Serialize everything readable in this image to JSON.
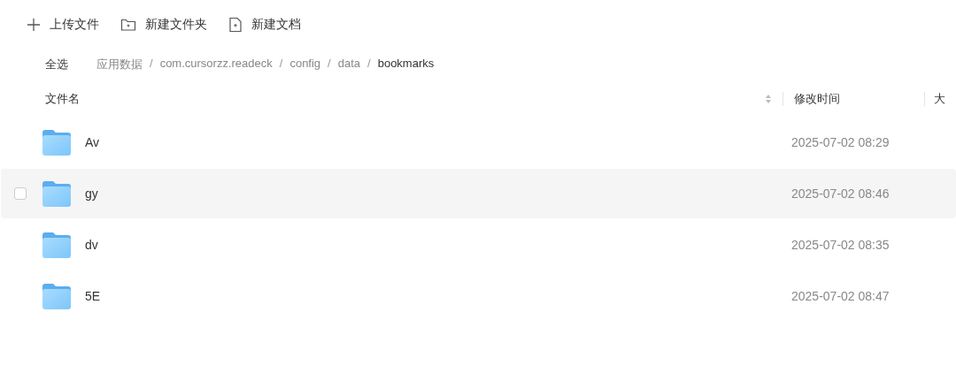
{
  "toolbar": [
    {
      "kind": "upload",
      "label": "上传文件"
    },
    {
      "kind": "folder",
      "label": "新建文件夹"
    },
    {
      "kind": "doc",
      "label": "新建文档"
    }
  ],
  "select_all": "全选",
  "breadcrumb": [
    {
      "label": "应用数据",
      "current": false
    },
    {
      "label": "com.cursorzz.readeck",
      "current": false
    },
    {
      "label": "config",
      "current": false
    },
    {
      "label": "data",
      "current": false
    },
    {
      "label": "bookmarks",
      "current": true
    }
  ],
  "separator": "/",
  "columns": [
    "文件名",
    "修改时间",
    "大"
  ],
  "rows": [
    {
      "name": "Av",
      "modified": "2025-07-02 08:29",
      "hovered": false,
      "checked": false
    },
    {
      "name": "gy",
      "modified": "2025-07-02 08:46",
      "hovered": true,
      "checked": false
    },
    {
      "name": "dv",
      "modified": "2025-07-02 08:35",
      "hovered": false,
      "checked": false
    },
    {
      "name": "5E",
      "modified": "2025-07-02 08:47",
      "hovered": false,
      "checked": false
    }
  ]
}
